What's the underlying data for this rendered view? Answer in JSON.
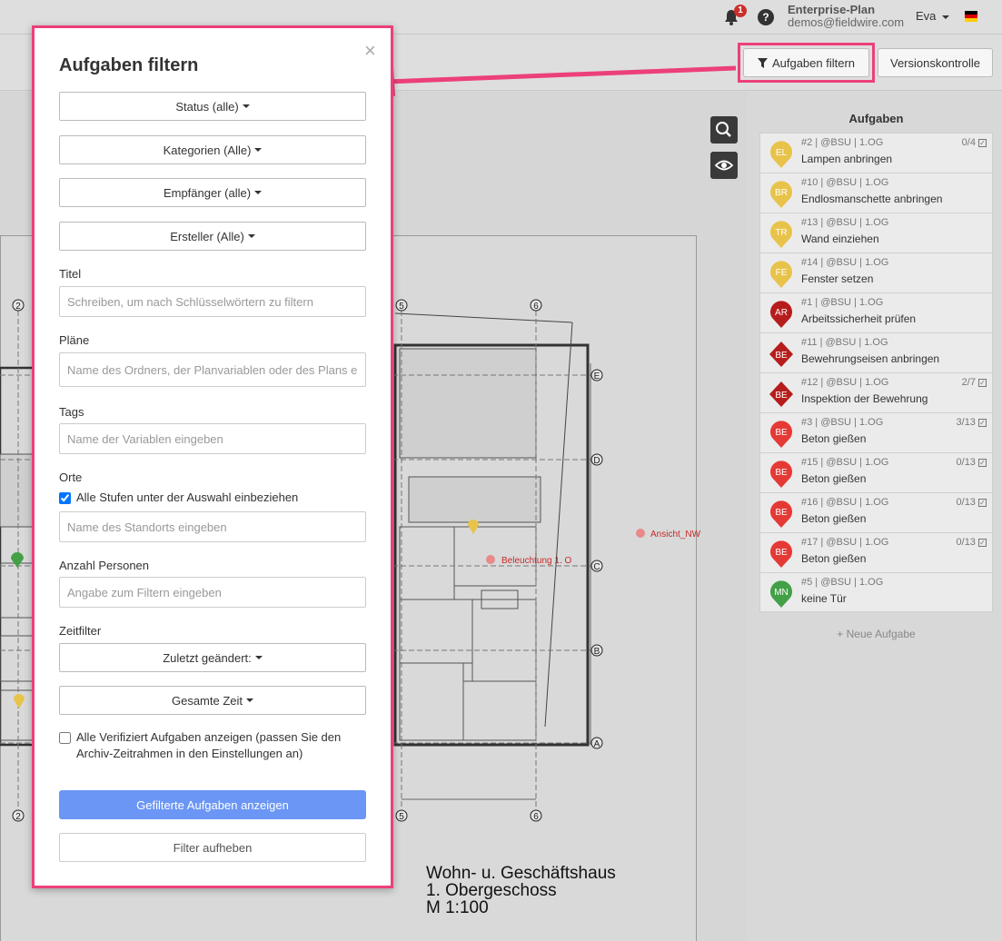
{
  "header": {
    "notification_count": "1",
    "help_label": "?",
    "plan_name": "Enterprise-Plan",
    "plan_email": "demos@fieldwire.com",
    "user_name": "Eva"
  },
  "toolbar": {
    "filter_button": "Aufgaben filtern",
    "version_button": "Versionskontrolle"
  },
  "drawing": {
    "title_line1": "Wohn- u. Geschäftshaus",
    "title_line2": "1. Obergeschoss",
    "title_line3": "M 1:100",
    "label_ansicht": "Ansicht_NW",
    "label_beleuchtung": "Beleuchtung 1. O",
    "grid_top": [
      "2",
      "5",
      "6"
    ],
    "grid_right": [
      "E",
      "D",
      "C",
      "B",
      "A"
    ],
    "grid_bottom": [
      "2",
      "5",
      "6"
    ]
  },
  "tasks_panel": {
    "header": "Aufgaben",
    "new_task": "+ Neue Aufgabe",
    "items": [
      {
        "pin": "EL",
        "color": "#e8c34a",
        "shape": "pin",
        "meta": "#2 | @BSU | 1.OG",
        "title": "Lampen anbringen",
        "count": "0/4"
      },
      {
        "pin": "BR",
        "color": "#e8c34a",
        "shape": "pin",
        "meta": "#10 | @BSU | 1.OG",
        "title": "Endlosmanschette anbringen",
        "count": ""
      },
      {
        "pin": "TR",
        "color": "#e8c34a",
        "shape": "pin",
        "meta": "#13 | @BSU | 1.OG",
        "title": "Wand einziehen",
        "count": ""
      },
      {
        "pin": "FE",
        "color": "#e8c34a",
        "shape": "pin",
        "meta": "#14 | @BSU | 1.OG",
        "title": "Fenster setzen",
        "count": ""
      },
      {
        "pin": "AR",
        "color": "#b71c1c",
        "shape": "pin",
        "meta": "#1 | @BSU | 1.OG",
        "title": "Arbeitssicherheit prüfen",
        "count": ""
      },
      {
        "pin": "BE",
        "color": "#b71c1c",
        "shape": "diamond",
        "meta": "#11 | @BSU | 1.OG",
        "title": "Bewehrungseisen anbringen",
        "count": ""
      },
      {
        "pin": "BE",
        "color": "#b71c1c",
        "shape": "diamond",
        "meta": "#12 | @BSU | 1.OG",
        "title": "Inspektion der Bewehrung",
        "count": "2/7"
      },
      {
        "pin": "BE",
        "color": "#e53935",
        "shape": "pin",
        "meta": "#3 | @BSU | 1.OG",
        "title": "Beton gießen",
        "count": "3/13"
      },
      {
        "pin": "BE",
        "color": "#e53935",
        "shape": "pin",
        "meta": "#15 | @BSU | 1.OG",
        "title": "Beton gießen",
        "count": "0/13"
      },
      {
        "pin": "BE",
        "color": "#e53935",
        "shape": "pin",
        "meta": "#16 | @BSU | 1.OG",
        "title": "Beton gießen",
        "count": "0/13"
      },
      {
        "pin": "BE",
        "color": "#e53935",
        "shape": "pin",
        "meta": "#17 | @BSU | 1.OG",
        "title": "Beton gießen",
        "count": "0/13"
      },
      {
        "pin": "MN",
        "color": "#43a047",
        "shape": "pin",
        "meta": "#5 | @BSU | 1.OG",
        "title": "keine Tür",
        "count": ""
      }
    ]
  },
  "modal": {
    "title": "Aufgaben filtern",
    "close": "×",
    "status_dd": "Status (alle)",
    "category_dd": "Kategorien (Alle)",
    "recipient_dd": "Empfänger (alle)",
    "creator_dd": "Ersteller (Alle)",
    "title_label": "Titel",
    "title_placeholder": "Schreiben, um nach Schlüsselwörtern zu filtern",
    "plans_label": "Pläne",
    "plans_placeholder": "Name des Ordners, der Planvariablen oder des Plans eingeben",
    "tags_label": "Tags",
    "tags_placeholder": "Name der Variablen eingeben",
    "locations_label": "Orte",
    "include_levels_label": "Alle Stufen unter der Auswahl einbeziehen",
    "location_placeholder": "Name des Standorts eingeben",
    "people_label": "Anzahl Personen",
    "people_placeholder": "Angabe zum Filtern eingeben",
    "time_label": "Zeitfilter",
    "modified_dd": "Zuletzt geändert:",
    "total_time_dd": "Gesamte Zeit",
    "verified_label": "Alle Verifiziert Aufgaben anzeigen (passen Sie den Archiv-Zeitrahmen in den Einstellungen an)",
    "apply_button": "Gefilterte Aufgaben anzeigen",
    "clear_button": "Filter aufheben"
  }
}
